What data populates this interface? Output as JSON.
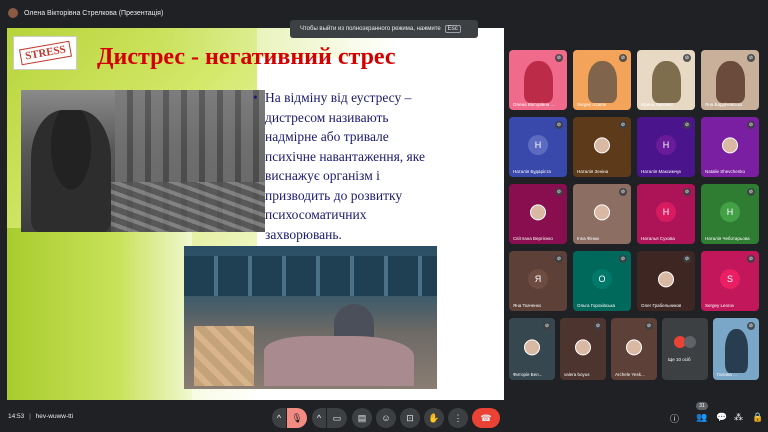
{
  "window": {
    "title": "Олена Вікторівна Стрелкова (Презентація)"
  },
  "toast": {
    "text": "Чтобы выйти из полноэкранного режима, нажмите",
    "key": "Esc"
  },
  "slide": {
    "logo_text": "STRESS",
    "title": "Дистрес - негативний стрес",
    "bullet_char": "•",
    "bullet_lines": [
      "На відміну від еустресу –",
      "дистресом називають",
      "надмірне або тривале",
      "психічне навантаження, яке",
      "виснажує організм і",
      "призводить до розвитку",
      "психосоматичних",
      "захворювань."
    ]
  },
  "participants": [
    {
      "name": "Олена Вікторівна ...",
      "type": "video",
      "bg": "#f06a8b",
      "accent": "#b3203c"
    },
    {
      "name": "Sergey Azarov",
      "type": "video",
      "bg": "#f4a35a",
      "accent": "#6b5a4a"
    },
    {
      "name": "Ирина Лисенко",
      "type": "video",
      "bg": "#e7d9c3",
      "accent": "#6b5b3a"
    },
    {
      "name": "Яна Бардічевська",
      "type": "video",
      "bg": "#c9b09a",
      "accent": "#5b3a2a"
    },
    {
      "name": "Наталія Бударіста",
      "type": "initial",
      "initial": "Н",
      "bg": "#3949ab",
      "circle": "#5c6bc0"
    },
    {
      "name": "Наталія Зеніна",
      "type": "photo",
      "bg": "#5d3a1a"
    },
    {
      "name": "Наталія Максимчук",
      "type": "initial",
      "initial": "Н",
      "bg": "#4a148c",
      "circle": "#6a1b9a"
    },
    {
      "name": "Natalie Shevchenko",
      "type": "photo",
      "bg": "#7b1fa2"
    },
    {
      "name": "Світлана Вергієнко",
      "type": "photo",
      "bg": "#880e4f"
    },
    {
      "name": "Inna Фінюк",
      "type": "photo",
      "bg": "#8d6e63"
    },
    {
      "name": "Наталья Сухова",
      "type": "initial",
      "initial": "Н",
      "bg": "#ad1457",
      "circle": "#d81b60"
    },
    {
      "name": "Наталія Чеботарьова",
      "type": "initial",
      "initial": "Н",
      "bg": "#2e7d32",
      "circle": "#43a047"
    },
    {
      "name": "Яна Ткаченко",
      "type": "initial",
      "initial": "Я",
      "bg": "#5d4037",
      "circle": "#6d4c41"
    },
    {
      "name": "Ольга Горохівська",
      "type": "initial",
      "initial": "О",
      "bg": "#00695c",
      "circle": "#00796b"
    },
    {
      "name": "Олег Грабельников",
      "type": "photo",
      "bg": "#3e2723"
    },
    {
      "name": "Sergey Leorov",
      "type": "initial",
      "initial": "S",
      "bg": "#c2185b",
      "circle": "#e91e63"
    },
    {
      "name": "Фиторія Бел...",
      "type": "photo",
      "bg": "#37474f"
    },
    {
      "name": "valera boyus",
      "type": "photo",
      "bg": "#4e342e"
    },
    {
      "name": "Archele Yesk...",
      "type": "photo",
      "bg": "#5d4037"
    },
    {
      "name": "Ще 10 осіб",
      "type": "more",
      "bg": "#3c4043"
    },
    {
      "name": "Галина ...",
      "type": "video",
      "bg": "#7aa7c7",
      "accent": "#1a2a3a"
    }
  ],
  "bottom": {
    "time": "14:53",
    "meeting_code": "hev-wuww-tti",
    "people_count": "31"
  }
}
